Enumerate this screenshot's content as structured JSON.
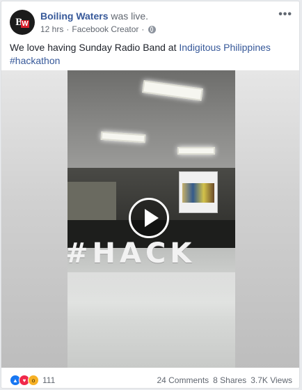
{
  "post": {
    "page_name": "Boiling Waters",
    "action": "was live.",
    "time": "12 hrs",
    "separator": "·",
    "source": "Facebook Creator",
    "privacy_icon": "globe-icon",
    "more_label": "•••",
    "text_prefix": "We love having Sunday Radio Band at ",
    "mention": "Indigitous Philippines",
    "hashtag": "#hackathon"
  },
  "avatar": {
    "letter_main": "B",
    "letter_accent": "W",
    "accent_color": "#d8202c"
  },
  "video": {
    "scene_text": "#HACK",
    "play_icon": "play-icon"
  },
  "footer": {
    "reaction_icons": [
      "like-icon",
      "love-icon",
      "wow-icon"
    ],
    "reaction_count": "111",
    "comments": "24 Comments",
    "shares": "8 Shares",
    "views": "3.7K Views"
  },
  "colors": {
    "link": "#365899",
    "text": "#1d2129",
    "meta": "#616770",
    "like": "#1877f2",
    "love": "#f0284a",
    "wow": "#f7b125"
  }
}
